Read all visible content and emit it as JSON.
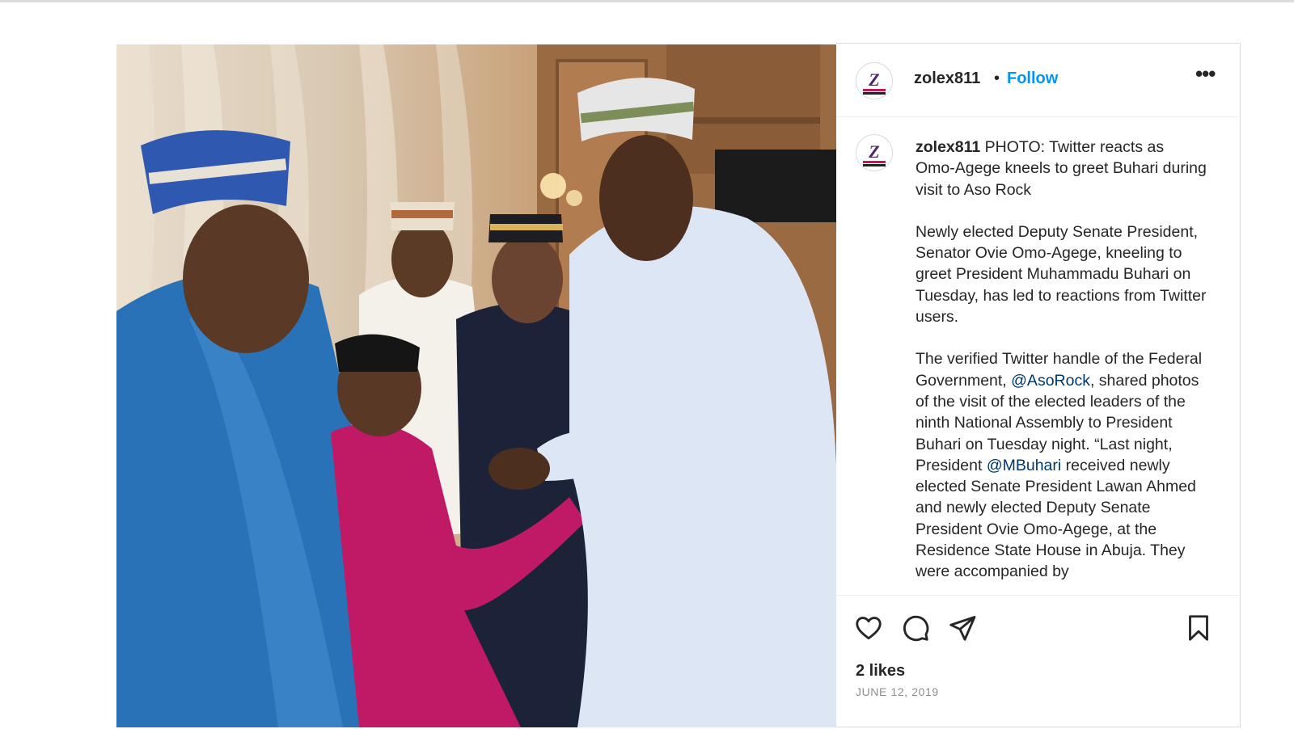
{
  "post": {
    "photo_alt": "",
    "author": {
      "username": "zolex811",
      "separator": "•",
      "follow_label": "Follow",
      "more_label": "•••"
    },
    "caption": {
      "username": "zolex811",
      "headline": "PHOTO: Twitter reacts as Omo-Agege kneels to greet Buhari during visit to Aso Rock",
      "paragraph_2": "Newly elected Deputy Senate President, Senator Ovie Omo-Agege, kneeling to greet President Muhammadu Buhari on Tuesday, has led to reactions from Twitter users.",
      "p3_a": "The verified Twitter handle of the Federal Government, ",
      "mention_1": "@AsoRock",
      "p3_b": ", shared photos of the visit of the elected leaders of the ninth National Assembly to President Buhari on Tuesday night. “Last night, President ",
      "mention_2": "@MBuhari",
      "p3_c": " received newly elected Senate President Lawan Ahmed and newly elected Deputy Senate President Ovie Omo-Agege, at the Residence State House in Abuja. They were accompanied by"
    },
    "actions": {
      "like_icon": "heart-icon",
      "comment_icon": "comment-icon",
      "share_icon": "paper-plane-icon",
      "save_icon": "bookmark-icon"
    },
    "likes": "2 likes",
    "date": "JUNE 12, 2019"
  },
  "colors": {
    "follow": "#0095f6",
    "mention": "#00376b",
    "text": "#262626",
    "muted": "#8e8e8e",
    "border": "#dbdbdb"
  }
}
